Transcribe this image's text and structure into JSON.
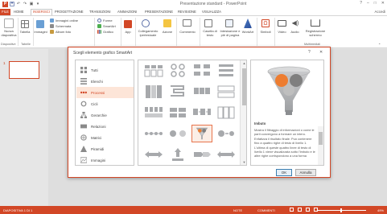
{
  "window": {
    "title": "Presentazione standard - PowerPoint",
    "account": "Accedi",
    "controls": [
      "?",
      "–",
      "□",
      "✕"
    ]
  },
  "tabs": {
    "file": "FILE",
    "items": [
      "HOME",
      "INSERISCI",
      "PROGETTAZIONE",
      "TRANSIZIONI",
      "ANIMAZIONI",
      "PRESENTAZIONE",
      "REVISIONE",
      "VISUALIZZA"
    ],
    "active_index": 1
  },
  "ribbon": {
    "new_slide": "Nuova diapositiva",
    "table": "Tabella",
    "images": "Immagini",
    "online_images": "Immagini online",
    "screenshot": "Schermata",
    "album": "Album foto",
    "shapes": "Forme",
    "smartart": "SmartArt",
    "chart": "Grafico",
    "apps": "App",
    "hyperlink": "Collegamento ipertestuale",
    "action": "Azione",
    "comment": "Commento",
    "textbox": "Casella di testo",
    "header_footer": "Intestazione e piè di pagina",
    "wordart": "WordArt",
    "symbols": "Simboli",
    "video": "Video",
    "audio": "Audio",
    "screen_recording": "Registrazione schermo",
    "groups": {
      "slides": "Diapositive",
      "tables": "Tabelle",
      "multimedia": "Multimediali"
    }
  },
  "slides_pane": {
    "slide_number": "1"
  },
  "dialog": {
    "title": "Scegli elemento grafico SmartArt",
    "help": "?",
    "close": "✕",
    "categories": [
      {
        "label": "Tutti",
        "icon": "all-layouts-icon"
      },
      {
        "label": "Elenchi",
        "icon": "list-layout-icon"
      },
      {
        "label": "Processi",
        "icon": "process-layout-icon",
        "selected": true
      },
      {
        "label": "Cicli",
        "icon": "cycle-layout-icon"
      },
      {
        "label": "Gerarchie",
        "icon": "hierarchy-layout-icon"
      },
      {
        "label": "Relazioni",
        "icon": "relationship-layout-icon"
      },
      {
        "label": "Matrici",
        "icon": "matrix-layout-icon"
      },
      {
        "label": "Piramidi",
        "icon": "pyramid-layout-icon"
      },
      {
        "label": "Immagini",
        "icon": "picture-layout-icon"
      }
    ],
    "preview": {
      "name": "Imbuto",
      "description": "Mostra il filtraggio di informazioni o come le parti convergono a formare un intero. Enfatizza il risultato finale. Può contenere fino a quattro righe di testo di livello 1. L'ultima di queste quattro linee di testo di livello 1 viene visualizzata sotto l'imbuto e le altre righe corrispondono a una forma"
    },
    "ok_label": "OK",
    "cancel_label": "Annulla"
  },
  "status_bar": {
    "slide_info": "DIAPOSITIVA 1 DI 1",
    "notes": "NOTE",
    "comments": "COMMENTI",
    "zoom": "49%"
  },
  "colors": {
    "accent": "#d24726",
    "selected_bg": "#fde5d8",
    "funnel_gray": "#a7a9ac",
    "funnel_orange": "#ed7d31"
  }
}
